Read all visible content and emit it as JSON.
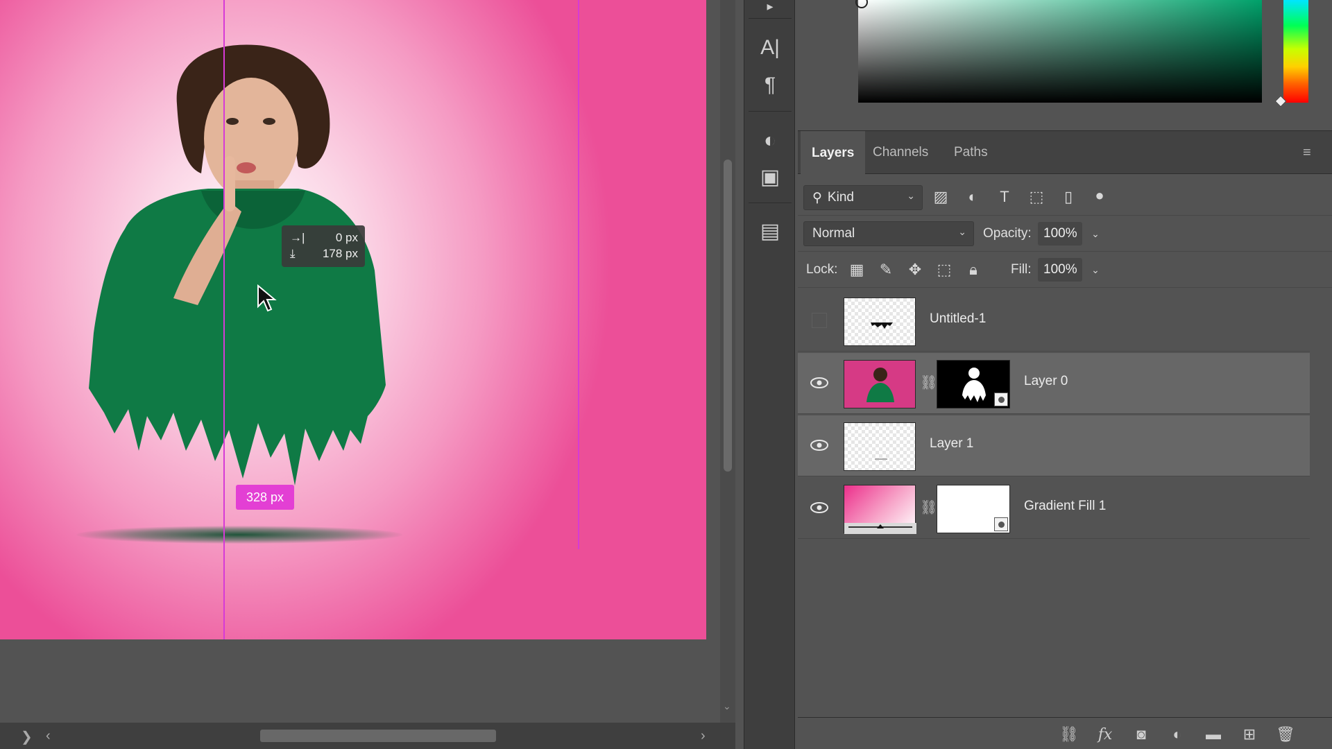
{
  "canvas": {
    "hud": {
      "x_icon": "→|",
      "x_value": "0 px",
      "y_icon": "⤓",
      "y_value": "178 px"
    },
    "measure_label": "328 px"
  },
  "toolstrip": {
    "items": [
      {
        "name": "character-icon",
        "glyph": "A|"
      },
      {
        "name": "paragraph-icon",
        "glyph": "¶"
      },
      {
        "name": "adjustments-icon",
        "glyph": "◐"
      },
      {
        "name": "libraries-icon",
        "glyph": "▣"
      },
      {
        "name": "properties-icon",
        "glyph": "▤"
      }
    ]
  },
  "color_panel": {
    "base_color": "#00a16a"
  },
  "layers_panel": {
    "tabs": [
      {
        "label": "Layers",
        "active": true
      },
      {
        "label": "Channels",
        "active": false
      },
      {
        "label": "Paths",
        "active": false
      }
    ],
    "filter": {
      "label": "Kind",
      "icons": [
        "image-filter-icon",
        "adjustment-filter-icon",
        "type-filter-icon",
        "shape-filter-icon",
        "smart-object-filter-icon",
        "filter-toggle-icon"
      ]
    },
    "blend_mode": "Normal",
    "opacity_label": "Opacity:",
    "opacity_value": "100%",
    "lock_label": "Lock:",
    "fill_label": "Fill:",
    "fill_value": "100%",
    "layers": [
      {
        "name": "Untitled-1",
        "visible": false,
        "selected": false,
        "has_mask": false
      },
      {
        "name": "Layer 0",
        "visible": true,
        "selected": true,
        "has_mask": true
      },
      {
        "name": "Layer 1",
        "visible": true,
        "selected": true,
        "has_mask": false
      },
      {
        "name": "Gradient Fill 1",
        "visible": true,
        "selected": false,
        "has_mask": true
      }
    ],
    "footer_icons": [
      "link-layers-icon",
      "fx-icon",
      "add-mask-icon",
      "adjustment-layer-icon",
      "group-folder-icon",
      "new-layer-icon",
      "trash-icon"
    ]
  },
  "colors": {
    "guide": "#d63ad6",
    "measure_badge": "#e33fd4",
    "hoodie": "#0f7a45"
  }
}
